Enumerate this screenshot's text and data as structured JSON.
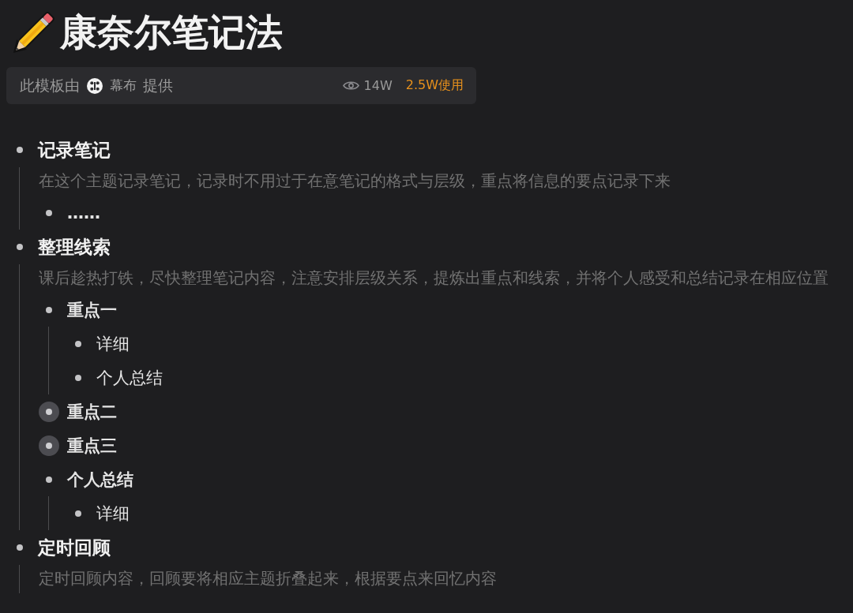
{
  "title": "康奈尔笔记法",
  "template_bar": {
    "prefix": "此模板由",
    "provider": "幕布",
    "suffix": "提供",
    "views": "14W",
    "uses": "2.5W使用"
  },
  "outline": [
    {
      "text": "记录笔记",
      "bold": true,
      "collapsed": false,
      "note": "在这个主题记录笔记，记录时不用过于在意笔记的格式与层级，重点将信息的要点记录下来",
      "children": [
        {
          "text": "……",
          "bold": true,
          "collapsed": false
        }
      ]
    },
    {
      "text": "整理线索",
      "bold": true,
      "collapsed": false,
      "note": "课后趁热打铁，尽快整理笔记内容，注意安排层级关系，提炼出重点和线索，并将个人感受和总结记录在相应位置",
      "children": [
        {
          "text": "重点一",
          "bold": true,
          "collapsed": false,
          "children": [
            {
              "text": "详细",
              "bold": false,
              "collapsed": false
            },
            {
              "text": "个人总结",
              "bold": false,
              "collapsed": false
            }
          ]
        },
        {
          "text": "重点二",
          "bold": true,
          "collapsed": true
        },
        {
          "text": "重点三",
          "bold": true,
          "collapsed": true
        },
        {
          "text": "个人总结",
          "bold": true,
          "collapsed": false,
          "children": [
            {
              "text": "详细",
              "bold": false,
              "collapsed": false
            }
          ]
        }
      ]
    },
    {
      "text": "定时回顾",
      "bold": true,
      "collapsed": false,
      "note": "定时回顾内容，回顾要将相应主题折叠起来，根据要点来回忆内容"
    }
  ]
}
